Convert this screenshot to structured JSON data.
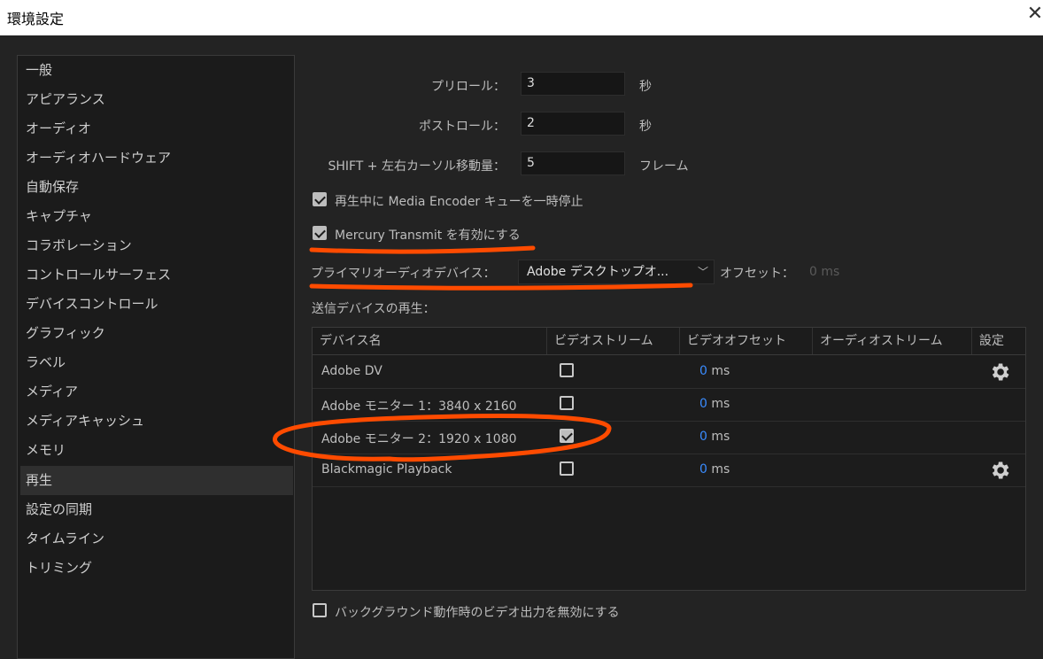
{
  "window": {
    "title": "環境設定",
    "close_glyph": "✕"
  },
  "sidebar": {
    "items": [
      {
        "label": "一般"
      },
      {
        "label": "アピアランス"
      },
      {
        "label": "オーディオ"
      },
      {
        "label": "オーディオハードウェア"
      },
      {
        "label": "自動保存"
      },
      {
        "label": "キャプチャ"
      },
      {
        "label": "コラボレーション"
      },
      {
        "label": "コントロールサーフェス"
      },
      {
        "label": "デバイスコントロール"
      },
      {
        "label": "グラフィック"
      },
      {
        "label": "ラベル"
      },
      {
        "label": "メディア"
      },
      {
        "label": "メディアキャッシュ"
      },
      {
        "label": "メモリ"
      },
      {
        "label": "再生",
        "selected": true
      },
      {
        "label": "設定の同期"
      },
      {
        "label": "タイムライン"
      },
      {
        "label": "トリミング"
      }
    ]
  },
  "playback": {
    "preroll_label": "プリロール：",
    "preroll_value": "3",
    "preroll_unit": "秒",
    "postroll_label": "ポストロール：",
    "postroll_value": "2",
    "postroll_unit": "秒",
    "shift_label": "SHIFT + 左右カーソル移動量：",
    "shift_value": "5",
    "shift_unit": "フレーム",
    "pause_encoder_label": "再生中に Media Encoder キューを一時停止",
    "pause_encoder_checked": true,
    "mercury_label": "Mercury Transmit を有効にする",
    "mercury_checked": true,
    "audio_device_label": "プライマリオーディオデバイス：",
    "audio_device_value": "Adobe デスクトップオ...",
    "offset_label": "オフセット：",
    "offset_value": "0",
    "offset_unit": "ms",
    "transmit_section_label": "送信デバイスの再生：",
    "disable_bg_label": "バックグラウンド動作時のビデオ出力を無効にする",
    "disable_bg_checked": false
  },
  "device_table": {
    "headers": {
      "name": "デバイス名",
      "video_stream": "ビデオストリーム",
      "video_offset": "ビデオオフセット",
      "audio_stream": "オーディオストリーム",
      "settings": "設定"
    },
    "rows": [
      {
        "name": "Adobe DV",
        "video_stream": false,
        "offset": "0",
        "unit": "ms",
        "has_settings": true
      },
      {
        "name": "Adobe モニター 1：3840 x 2160",
        "video_stream": false,
        "offset": "0",
        "unit": "ms",
        "has_settings": false
      },
      {
        "name": "Adobe モニター 2：1920 x 1080",
        "video_stream": true,
        "offset": "0",
        "unit": "ms",
        "has_settings": false
      },
      {
        "name": "Blackmagic Playback",
        "video_stream": false,
        "offset": "0",
        "unit": "ms",
        "has_settings": true
      }
    ]
  },
  "annotation_color": "#ff4b00",
  "accent_color": "#3a8cff"
}
